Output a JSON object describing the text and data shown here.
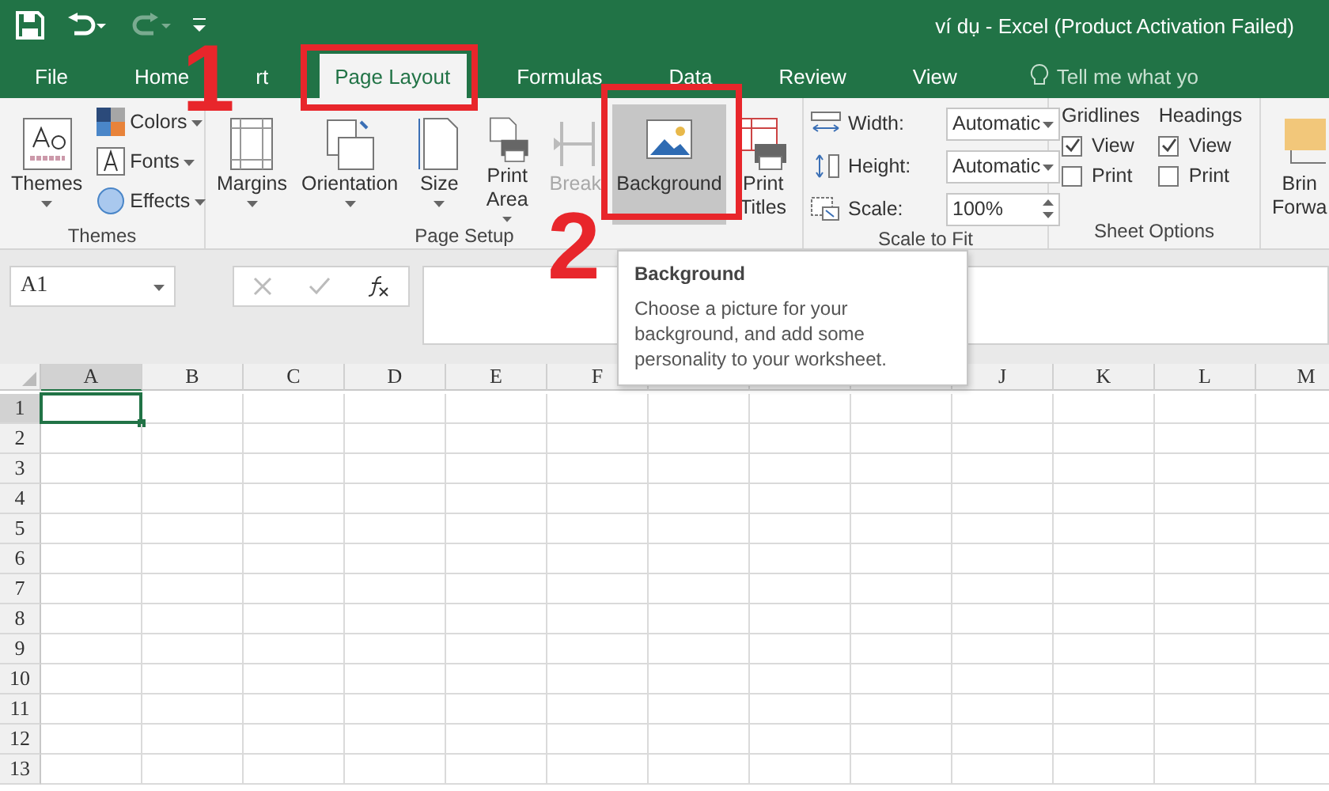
{
  "title_bar": {
    "title": "ví dụ - Excel (Product Activation Failed)",
    "redo_disabled": true
  },
  "tabs": [
    {
      "label": "File",
      "selected": false
    },
    {
      "label": "Home",
      "selected": false
    },
    {
      "label": "rt",
      "selected": false
    },
    {
      "label": "Page Layout",
      "selected": true
    },
    {
      "label": "Formulas",
      "selected": false
    },
    {
      "label": "Data",
      "selected": false
    },
    {
      "label": "Review",
      "selected": false
    },
    {
      "label": "View",
      "selected": false
    }
  ],
  "tell_me": {
    "placeholder": "Tell me what yo"
  },
  "ribbon": {
    "themes": {
      "label": "Themes",
      "button": "Themes",
      "options": [
        {
          "kind": "colors",
          "label": "Colors"
        },
        {
          "kind": "fonts",
          "label": "Fonts"
        },
        {
          "kind": "effects",
          "label": "Effects"
        }
      ]
    },
    "page_setup": {
      "label": "Page Setup",
      "buttons": [
        {
          "kind": "margins",
          "lines": [
            "Margins"
          ],
          "dropdown": true,
          "disabled": false,
          "selected": false
        },
        {
          "kind": "orientation",
          "lines": [
            "Orientation"
          ],
          "dropdown": true,
          "disabled": false,
          "selected": false
        },
        {
          "kind": "size",
          "lines": [
            "Size"
          ],
          "dropdown": true,
          "disabled": false,
          "selected": false
        },
        {
          "kind": "printarea",
          "lines": [
            "Print",
            "Area"
          ],
          "dropdown": true,
          "disabled": false,
          "selected": false
        },
        {
          "kind": "breaks",
          "lines": [
            "Break"
          ],
          "dropdown": false,
          "disabled": true,
          "selected": false
        },
        {
          "kind": "background",
          "lines": [
            "Background"
          ],
          "dropdown": false,
          "disabled": false,
          "selected": true
        },
        {
          "kind": "printtitles",
          "lines": [
            "Print",
            "Titles"
          ],
          "dropdown": false,
          "disabled": false,
          "selected": false
        }
      ]
    },
    "scale_to_fit": {
      "label": "Scale to Fit",
      "fields": [
        {
          "kind": "width",
          "label": "Width:",
          "value": "Automatic"
        },
        {
          "kind": "height",
          "label": "Height:",
          "value": "Automatic"
        },
        {
          "kind": "scale",
          "label": "Scale:",
          "value": "100%"
        }
      ]
    },
    "sheet_options": {
      "label": "Sheet Options",
      "columns": [
        {
          "title": "Gridlines",
          "options": [
            {
              "label": "View",
              "checked": true
            },
            {
              "label": "Print",
              "checked": false
            }
          ]
        },
        {
          "title": "Headings",
          "options": [
            {
              "label": "View",
              "checked": true
            },
            {
              "label": "Print",
              "checked": false
            }
          ]
        }
      ]
    },
    "arrange": {
      "lines": [
        "Brin",
        "Forwa"
      ]
    }
  },
  "formula_bar": {
    "name_box": "A1"
  },
  "grid": {
    "columns": [
      {
        "label": "A",
        "selected": true
      },
      {
        "label": "B",
        "selected": false
      },
      {
        "label": "C",
        "selected": false
      },
      {
        "label": "D",
        "selected": false
      },
      {
        "label": "E",
        "selected": false
      },
      {
        "label": "F",
        "selected": false
      },
      {
        "selected": false
      },
      {
        "selected": false
      },
      {
        "selected": false
      },
      {
        "label": "J",
        "selected": false
      },
      {
        "label": "K",
        "selected": false
      },
      {
        "label": "L",
        "selected": false
      },
      {
        "label": "M",
        "selected": false
      }
    ],
    "rows": [
      {
        "label": "1",
        "selected": true
      },
      {
        "label": "2",
        "selected": false
      },
      {
        "label": "3",
        "selected": false
      },
      {
        "label": "4",
        "selected": false
      },
      {
        "label": "5",
        "selected": false
      },
      {
        "label": "6",
        "selected": false
      },
      {
        "label": "7",
        "selected": false
      },
      {
        "label": "8",
        "selected": false
      },
      {
        "label": "9",
        "selected": false
      },
      {
        "label": "10",
        "selected": false
      },
      {
        "label": "11",
        "selected": false
      },
      {
        "label": "12",
        "selected": false
      },
      {
        "label": "13",
        "selected": false
      }
    ]
  },
  "tooltip": {
    "title": "Background",
    "text": "Choose a picture for your background, and add some personality to your worksheet."
  },
  "annotations": [
    {
      "label": "1"
    },
    {
      "label": "2"
    }
  ]
}
